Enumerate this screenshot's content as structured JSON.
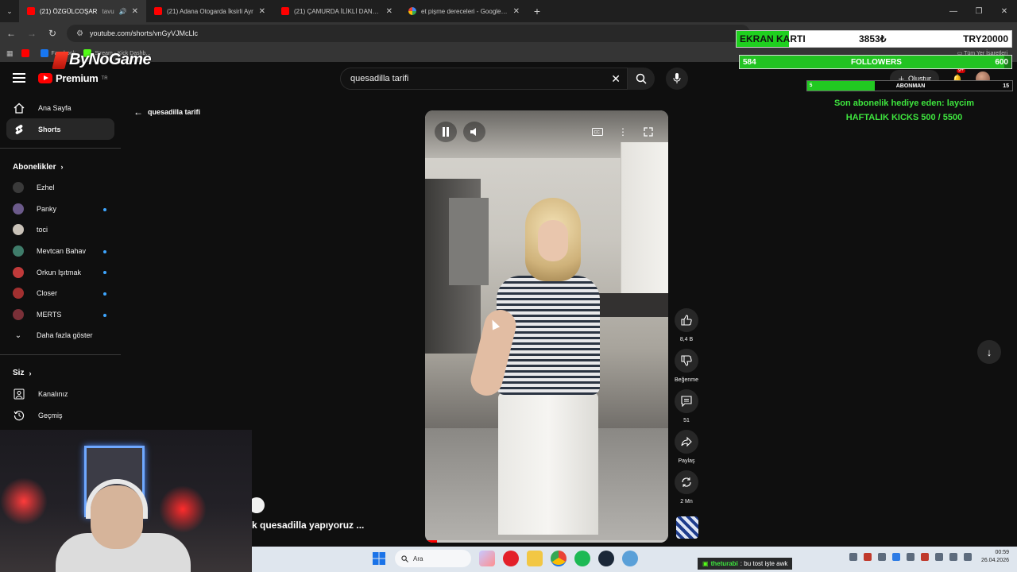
{
  "browser": {
    "tabs": [
      {
        "title": "(21) ÖZGÜLCOŞAR",
        "extra": "tavu",
        "active": true,
        "favicon": "youtube-favicon"
      },
      {
        "title": "(21) Adana Otogarda İksirli Ayr",
        "active": false,
        "favicon": "youtube-favicon"
      },
      {
        "title": "(21) ÇAMURDA İLİKLİ DANA İN",
        "active": false,
        "favicon": "youtube-favicon"
      },
      {
        "title": "et pişme dereceleri - Google'da",
        "active": false,
        "favicon": "google-favicon"
      }
    ],
    "url": "youtube.com/shorts/vnGyVJMcLlc",
    "bookmarks": [
      "Facebook",
      "Stream - Kick Dashb...",
      "Tüm Yer İşaretleri"
    ]
  },
  "youtube": {
    "logo_text": "Premium",
    "logo_sup": "TR",
    "search": {
      "value": "quesadilla tarifi",
      "placeholder": "Ara"
    },
    "create_label": "Oluştur",
    "notif_badge": "9+",
    "back_label": "quesadilla tarifi",
    "sidebar": {
      "main": [
        {
          "label": "Ana Sayfa",
          "icon": "home-icon"
        },
        {
          "label": "Shorts",
          "icon": "shorts-icon",
          "active": true
        }
      ],
      "subs_heading": "Abonelikler",
      "subscriptions": [
        {
          "label": "Ezhel",
          "color": "#3a3a3a",
          "dot": false
        },
        {
          "label": "Panky",
          "color": "#6b5a8a",
          "dot": true
        },
        {
          "label": "toci",
          "color": "#c9c2b8",
          "dot": false
        },
        {
          "label": "Mevtcan Bahav",
          "color": "#3f7c6a",
          "dot": true
        },
        {
          "label": "Orkun Işıtmak",
          "color": "#c03a3a",
          "dot": true
        },
        {
          "label": "Closer",
          "color": "#a23030",
          "dot": true
        },
        {
          "label": "MERTS",
          "color": "#7a3038",
          "dot": true
        }
      ],
      "show_more": "Daha fazla göster",
      "you_heading": "Siz",
      "you_items": [
        {
          "label": "Kanalınız",
          "icon": "user-icon"
        },
        {
          "label": "Geçmiş",
          "icon": "history-icon"
        }
      ]
    },
    "short": {
      "title": "k quesadilla yapıyoruz ...",
      "likes": "8,4 B",
      "dislike_label": "Beğenme",
      "comments": "51",
      "share_label": "Paylaş",
      "remix_label": "2 Mn",
      "progress_fraction": 0.05
    }
  },
  "overlay": {
    "brand": "ByNoGame",
    "gpu": {
      "label": "EKRAN KARTI",
      "amount": "3853₺",
      "goal": "TRY20000",
      "fraction": 0.19
    },
    "followers": {
      "current": "584",
      "label": "FOLLOWERS",
      "goal": "600",
      "fraction": 0.973
    },
    "subs": {
      "current": "5",
      "label": "ABONMAN",
      "goal": "15",
      "fraction": 0.33
    },
    "gift_line": "Son abonelik hediye eden: laycim",
    "kicks_line": "HAFTALIK KICKS 500 / 5500",
    "chat": {
      "user": "theturabi",
      "message": ": bu tost işte awk"
    }
  },
  "taskbar": {
    "search_placeholder": "Ara",
    "time": "00:59",
    "date": "26.04.2026"
  }
}
